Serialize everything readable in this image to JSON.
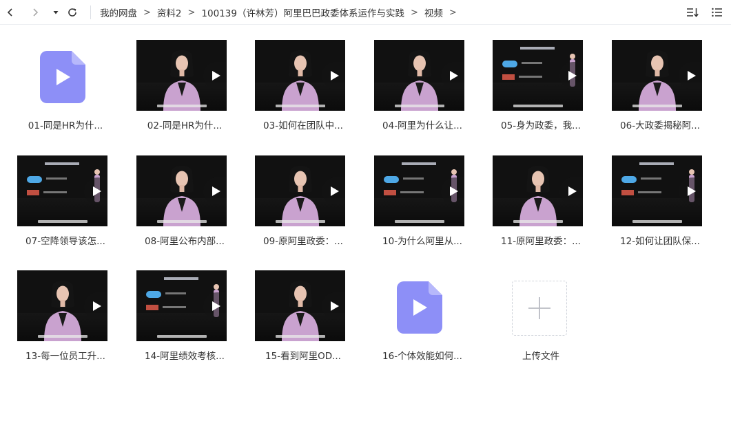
{
  "toolbar": {
    "back_icon": "chevron-left-icon",
    "forward_icon": "chevron-right-icon",
    "dropdown_icon": "caret-down-icon",
    "refresh_icon": "refresh-icon",
    "sort_icon": "sort-icon",
    "list_icon": "list-view-icon"
  },
  "breadcrumb": {
    "items": [
      "我的网盘",
      "资料2",
      "100139（许林芳）阿里巴巴政委体系运作与实践",
      "视频"
    ],
    "separator": ">"
  },
  "files": [
    {
      "label": "01-同是HR为什...",
      "kind": "video-doc"
    },
    {
      "label": "02-同是HR为什...",
      "kind": "video"
    },
    {
      "label": "03-如何在团队中...",
      "kind": "video"
    },
    {
      "label": "04-阿里为什么让...",
      "kind": "video"
    },
    {
      "label": "05-身为政委，我...",
      "kind": "slide"
    },
    {
      "label": "06-大政委揭秘阿...",
      "kind": "video"
    },
    {
      "label": "07-空降领导该怎...",
      "kind": "slide"
    },
    {
      "label": "08-阿里公布内部...",
      "kind": "video"
    },
    {
      "label": "09-原阿里政委：...",
      "kind": "video"
    },
    {
      "label": "10-为什么阿里从...",
      "kind": "slide"
    },
    {
      "label": "11-原阿里政委：...",
      "kind": "video"
    },
    {
      "label": "12-如何让团队保...",
      "kind": "slide"
    },
    {
      "label": "13-每一位员工升...",
      "kind": "video"
    },
    {
      "label": "14-阿里绩效考核...",
      "kind": "slide"
    },
    {
      "label": "15-看到阿里OD...",
      "kind": "video"
    },
    {
      "label": "16-个体效能如何...",
      "kind": "video-doc"
    }
  ],
  "upload": {
    "label": "上传文件",
    "icon": "plus-icon"
  },
  "colors": {
    "file_icon": "#8d8ff7",
    "jacket": "#c9a2cf",
    "background": "#ffffff"
  }
}
